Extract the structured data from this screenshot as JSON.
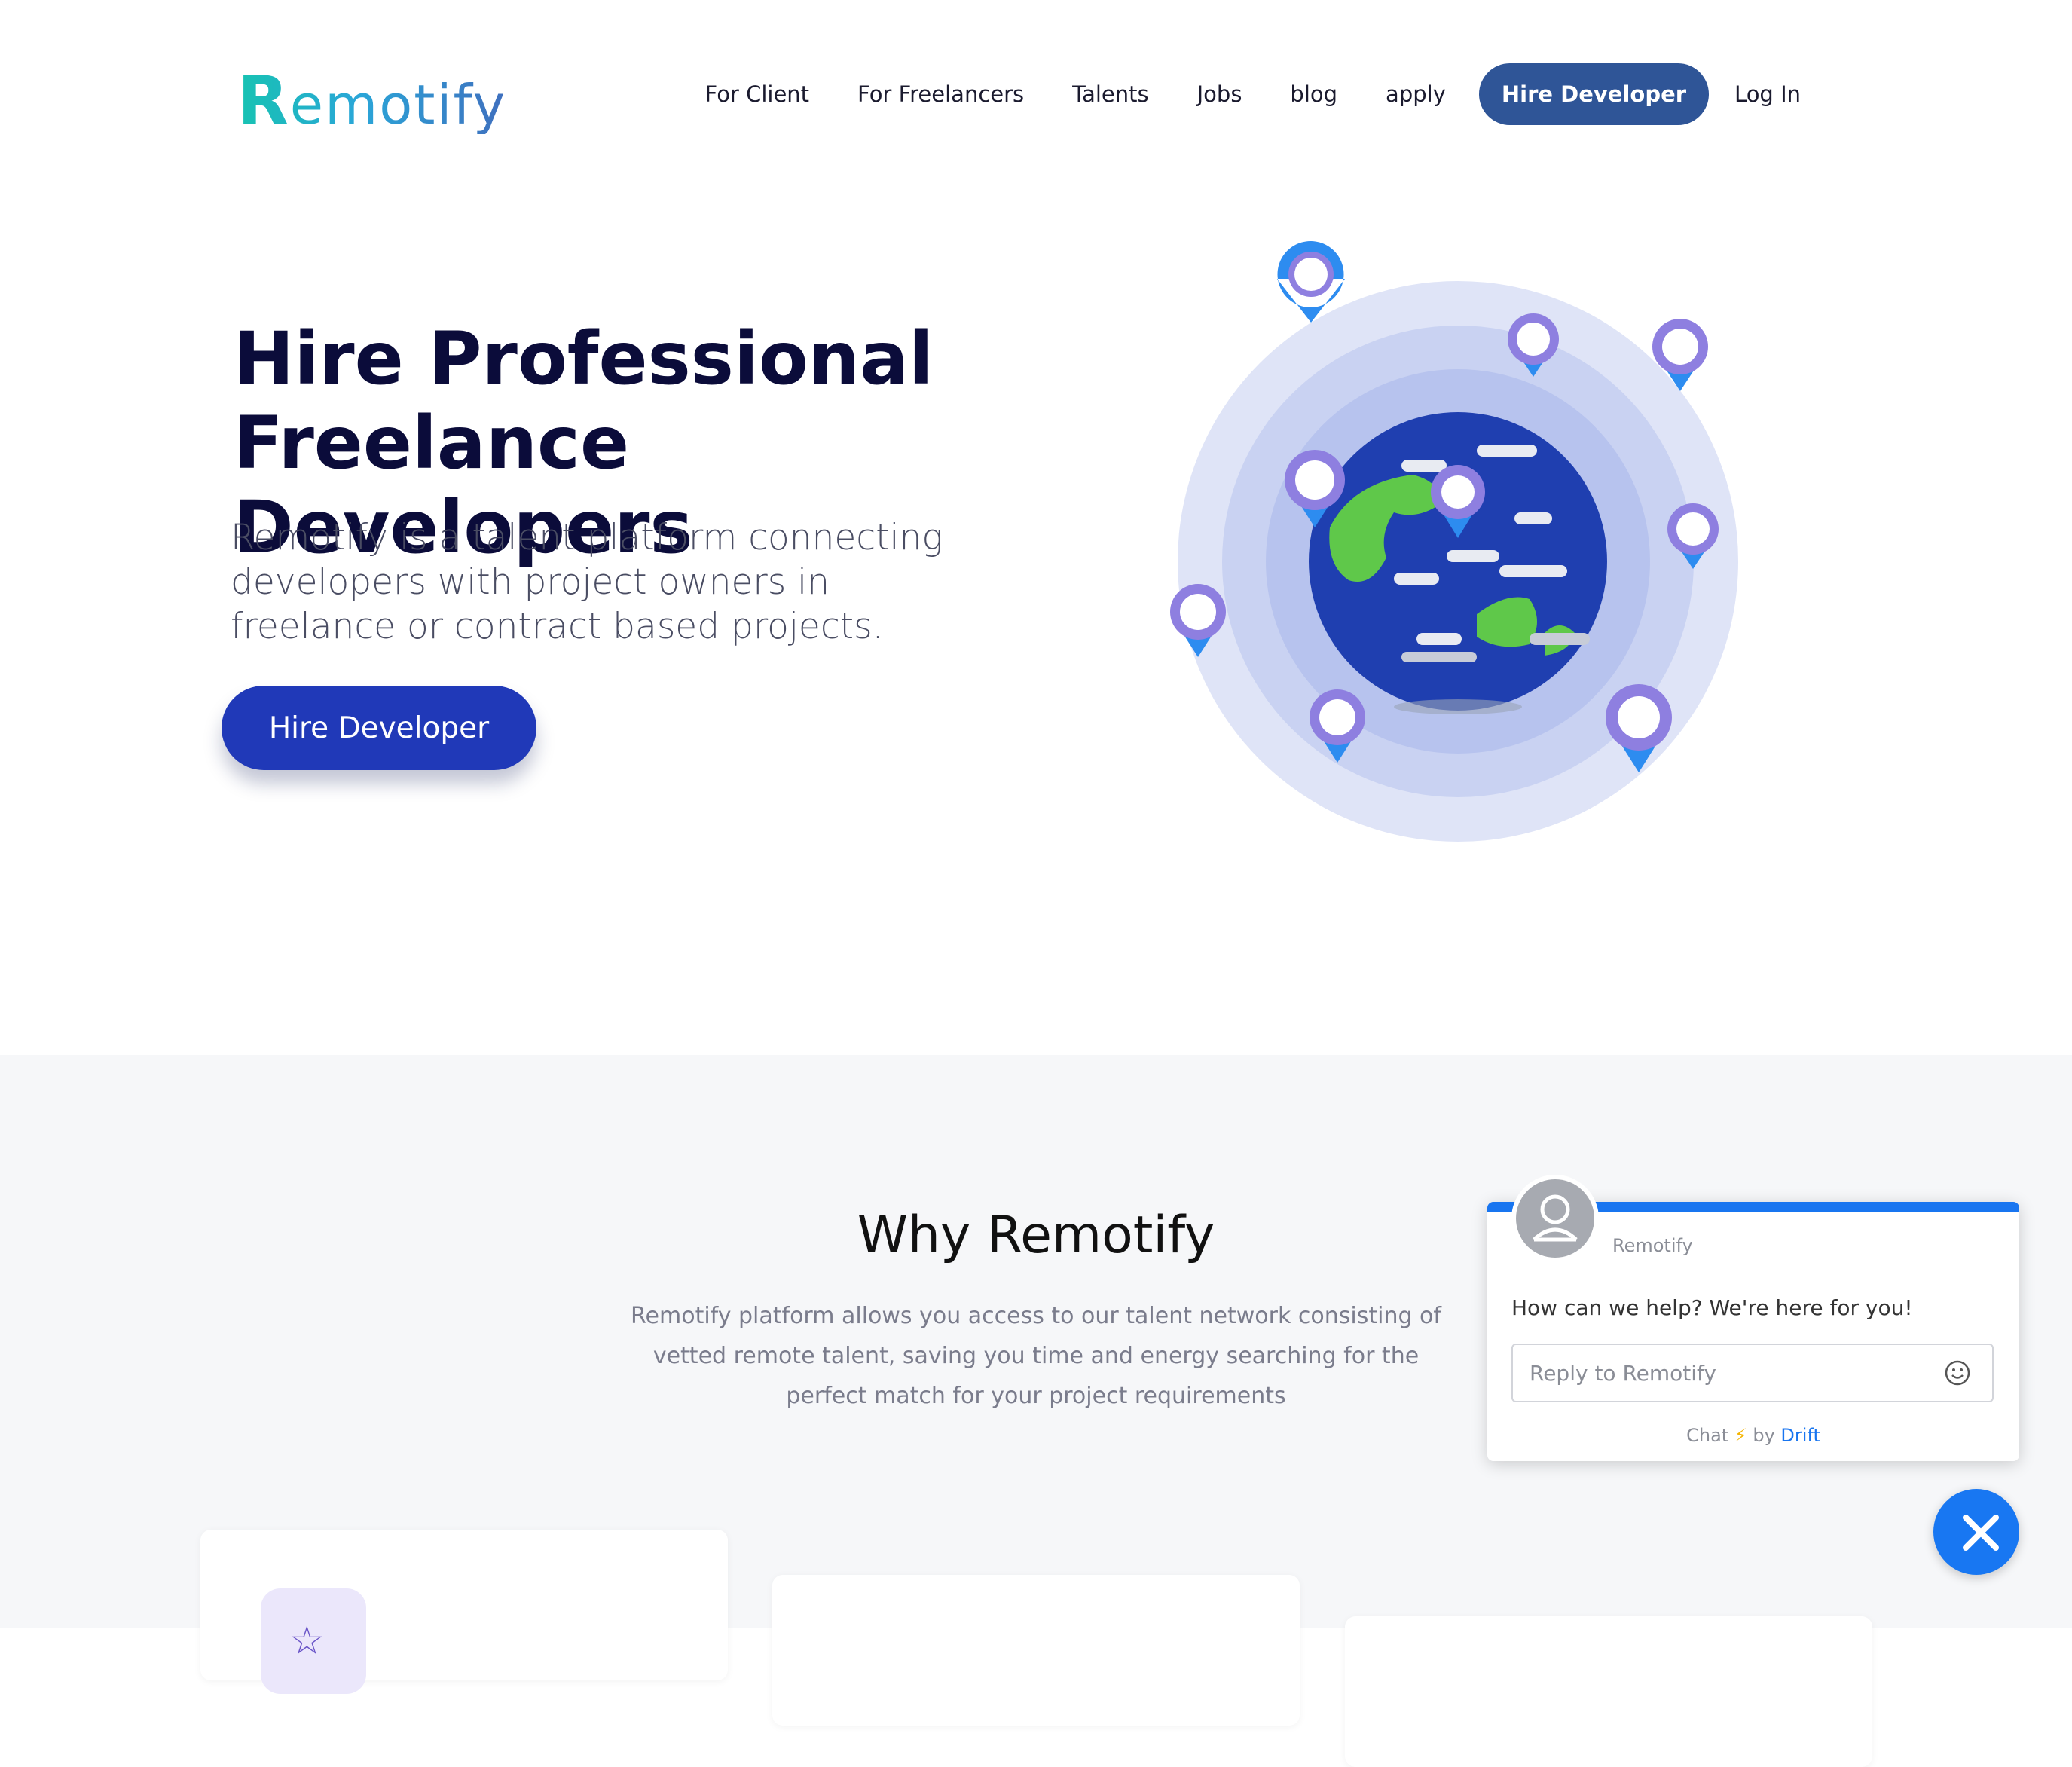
{
  "header": {
    "logo_first": "R",
    "logo_rest": "emotify",
    "nav": [
      "For Client",
      "For Freelancers",
      "Talents",
      "Jobs",
      "blog",
      "apply"
    ],
    "hire_button": "Hire Developer",
    "login": "Log In"
  },
  "hero": {
    "title_line1": "Hire Professional",
    "title_line2": "Freelance Developers",
    "subtitle": "Remotify is a talent platform connecting developers with project owners in freelance or contract based projects.",
    "cta": "Hire Developer"
  },
  "why": {
    "title": "Why Remotify",
    "text": "Remotify platform allows you access to our talent network consisting of vetted remote talent, saving you time and energy searching for the perfect match for your project requirements"
  },
  "chat": {
    "agent_name": "Remotify",
    "message": "How can we help? We're here for you!",
    "input_placeholder": "Reply to Remotify",
    "footer_chat": "Chat",
    "footer_by": "by",
    "footer_brand": "Drift"
  },
  "colors": {
    "primary_button": "#2039b8",
    "nav_button": "#2f5597",
    "chat_accent": "#1875f0"
  }
}
